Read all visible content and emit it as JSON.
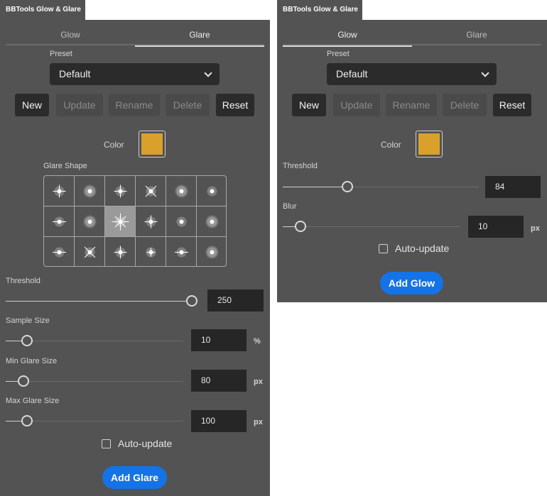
{
  "panel_title": "BBTools Glow & Glare",
  "left": {
    "tabs": [
      "Glow",
      "Glare"
    ],
    "active_tab": "Glare",
    "preset_label": "Preset",
    "preset_value": "Default",
    "buttons": {
      "new": "New",
      "update": "Update",
      "rename": "Rename",
      "delete": "Delete",
      "reset": "Reset"
    },
    "color_label": "Color",
    "color_value": "#d9a12c",
    "glare_shape_label": "Glare Shape",
    "glare_shape_selected_index": 8,
    "sliders": {
      "threshold": {
        "label": "Threshold",
        "value": "250",
        "unit": "",
        "level": 1.0
      },
      "sample_size": {
        "label": "Sample Size",
        "value": "10",
        "unit": "%",
        "level": 0.12
      },
      "min_glare_size": {
        "label": "Min Glare Size",
        "value": "80",
        "unit": "px",
        "level": 0.1
      },
      "max_glare_size": {
        "label": "Max Glare Size",
        "value": "100",
        "unit": "px",
        "level": 0.12
      }
    },
    "auto_update_label": "Auto-update",
    "auto_update_checked": false,
    "primary_button": "Add Glare"
  },
  "right": {
    "tabs": [
      "Glow",
      "Glare"
    ],
    "active_tab": "Glow",
    "preset_label": "Preset",
    "preset_value": "Default",
    "buttons": {
      "new": "New",
      "update": "Update",
      "rename": "Rename",
      "delete": "Delete",
      "reset": "Reset"
    },
    "color_label": "Color",
    "color_value": "#d9a12c",
    "sliders": {
      "threshold": {
        "label": "Threshold",
        "value": "84",
        "unit": "",
        "level": 0.33
      },
      "blur": {
        "label": "Blur",
        "value": "10",
        "unit": "px",
        "level": 0.1
      }
    },
    "auto_update_label": "Auto-update",
    "auto_update_checked": false,
    "primary_button": "Add Glow"
  },
  "colors": {
    "panel": "#535353",
    "primary": "#1473e6",
    "swatch": "#d9a12c",
    "field": "#262626"
  }
}
